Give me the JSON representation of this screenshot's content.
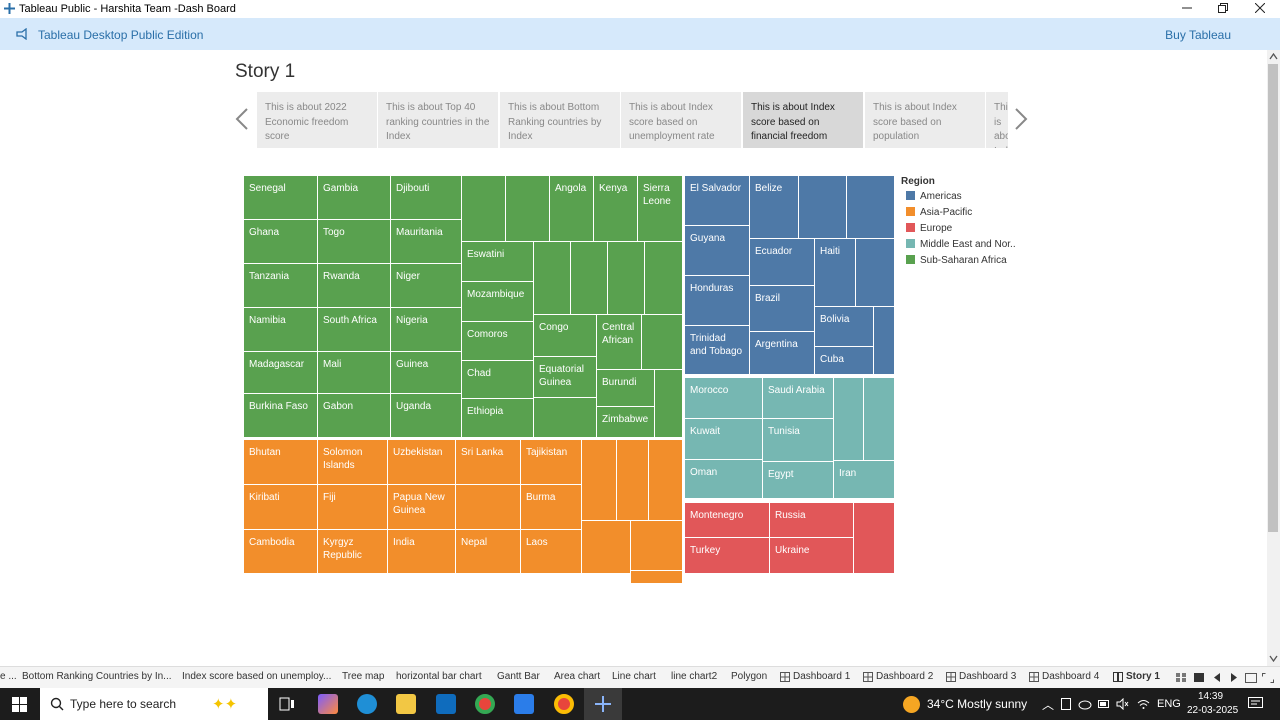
{
  "window": {
    "title": "Tableau Public - Harshita Team -Dash Board",
    "minimize_icon": "minimize-icon",
    "maximize_icon": "restore-icon",
    "close_icon": "close-icon"
  },
  "banner": {
    "edition": "Tableau Desktop Public Edition",
    "buy": "Buy Tableau"
  },
  "story": {
    "title": "Story 1",
    "points": [
      {
        "text": "This is about 2022 Economic freedom score"
      },
      {
        "text": "This is about Top 40 ranking countries in the Index"
      },
      {
        "text": "This is about Bottom Ranking countries by Index"
      },
      {
        "text": "This is about Index score based on unemployment rate"
      },
      {
        "text": "This is about Index score based on financial freedom"
      },
      {
        "text": "This is about Index score based on population"
      },
      {
        "text": "This is about Index score GDP"
      }
    ]
  },
  "treemap": {
    "tiles": {
      "senegal": "Senegal",
      "gambia": "Gambia",
      "djibouti": "Djibouti",
      "angola": "Angola",
      "kenya": "Kenya",
      "sierra_leone": "Sierra Leone",
      "ghana": "Ghana",
      "togo": "Togo",
      "mauritania": "Mauritania",
      "eswatini": "Eswatini",
      "tanzania": "Tanzania",
      "rwanda": "Rwanda",
      "niger": "Niger",
      "mozambique": "Mozambique",
      "namibia": "Namibia",
      "south_africa": "South Africa",
      "nigeria": "Nigeria",
      "comoros": "Comoros",
      "congo": "Congo",
      "central_african": "Central African",
      "madagascar": "Madagascar",
      "mali": "Mali",
      "guinea": "Guinea",
      "chad": "Chad",
      "equatorial_guinea": "Equatorial Guinea",
      "burundi": "Burundi",
      "burkina_faso": "Burkina Faso",
      "gabon": "Gabon",
      "uganda": "Uganda",
      "ethiopia": "Ethiopia",
      "zimbabwe": "Zimbabwe",
      "el_salvador": "El Salvador",
      "belize": "Belize",
      "guyana": "Guyana",
      "ecuador": "Ecuador",
      "haiti": "Haiti",
      "honduras": "Honduras",
      "brazil": "Brazil",
      "bolivia": "Bolivia",
      "trinidad": "Trinidad and Tobago",
      "argentina": "Argentina",
      "cuba": "Cuba",
      "morocco": "Morocco",
      "saudi_arabia": "Saudi Arabia",
      "kuwait": "Kuwait",
      "tunisia": "Tunisia",
      "oman": "Oman",
      "egypt": "Egypt",
      "iran": "Iran",
      "montenegro": "Montenegro",
      "russia": "Russia",
      "turkey": "Turkey",
      "ukraine": "Ukraine",
      "bhutan": "Bhutan",
      "solomon_islands": "Solomon Islands",
      "uzbekistan": "Uzbekistan",
      "sri_lanka": "Sri Lanka",
      "tajikistan": "Tajikistan",
      "kiribati": "Kiribati",
      "fiji": "Fiji",
      "papua": "Papua New Guinea",
      "burma": "Burma",
      "cambodia": "Cambodia",
      "kyrgyz": "Kyrgyz Republic",
      "india": "India",
      "nepal": "Nepal",
      "laos": "Laos"
    }
  },
  "legend": {
    "title": "Region",
    "items": [
      {
        "label": "Americas",
        "color": "#4e79a7"
      },
      {
        "label": "Asia-Pacific",
        "color": "#f28e2b"
      },
      {
        "label": "Europe",
        "color": "#e15759"
      },
      {
        "label": "Middle East and Nor..",
        "color": "#76b7b2"
      },
      {
        "label": "Sub-Saharan Africa",
        "color": "#59a14f"
      }
    ]
  },
  "sheet_tabs": [
    "e ...",
    "Bottom Ranking  Countries by In...",
    "Index score based on unemploy...",
    "Tree map",
    "horizontal bar chart",
    "Gantt Bar",
    "Area chart",
    "Line chart",
    "line chart2",
    "Polygon",
    "Dashboard 1",
    "Dashboard 2",
    "Dashboard 3",
    "Dashboard 4",
    "Story 1"
  ],
  "taskbar": {
    "search_placeholder": "Type here to search",
    "weather": "34°C  Mostly sunny",
    "language": "ENG",
    "time": "14:39",
    "date": "22-03-2025"
  }
}
